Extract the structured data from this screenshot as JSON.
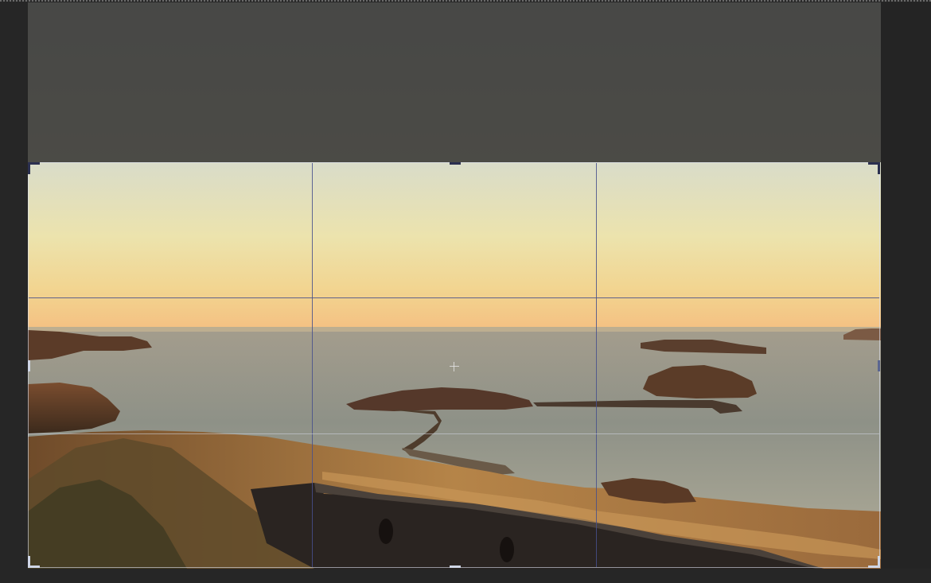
{
  "workspace": {
    "mode": "crop",
    "overlay": "rule-of-thirds",
    "colors": {
      "background": "#262626",
      "grid": "#46508c",
      "handle": "#2b3050",
      "sky_top": "#d9dcc9",
      "sky_horizon": "#f4c183",
      "sea": "#8f9488",
      "land": "#6b4630"
    }
  },
  "image": {
    "subject_icon": "landscape-photo-icon"
  }
}
